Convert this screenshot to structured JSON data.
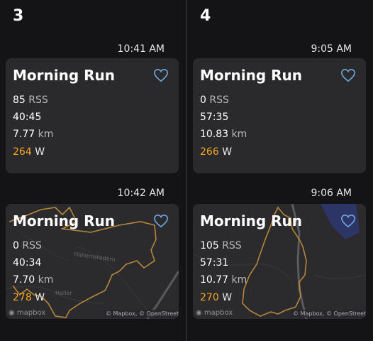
{
  "colors": {
    "background": "#121214",
    "card": "#2a2a2c",
    "power": "#f5a623",
    "heart": "#6fa8dc",
    "route": "#b8863a"
  },
  "columns": [
    {
      "day": "3",
      "activities": [
        {
          "time": "10:41 AM",
          "title": "Morning Run",
          "rss_value": "85",
          "rss_unit": "RSS",
          "duration": "40:45",
          "distance_value": "7.77",
          "distance_unit": "km",
          "power_value": "264",
          "power_unit": "W",
          "has_map": false,
          "favorite_icon": "heart-outline-icon"
        },
        {
          "time": "10:42 AM",
          "title": "Morning Run",
          "rss_value": "0",
          "rss_unit": "RSS",
          "duration": "40:34",
          "distance_value": "7.70",
          "distance_unit": "km",
          "power_value": "278",
          "power_unit": "W",
          "has_map": true,
          "map_labels": [
            "Hallernstedern",
            "Haller"
          ],
          "mapbox_logo": "mapbox",
          "map_attribution": "© Mapbox, © OpenStreetMap",
          "favorite_icon": "heart-outline-icon"
        }
      ]
    },
    {
      "day": "4",
      "activities": [
        {
          "time": "9:05 AM",
          "title": "Morning Run",
          "rss_value": "0",
          "rss_unit": "RSS",
          "duration": "57:35",
          "distance_value": "10.83",
          "distance_unit": "km",
          "power_value": "266",
          "power_unit": "W",
          "has_map": false,
          "favorite_icon": "heart-outline-icon"
        },
        {
          "time": "9:06 AM",
          "title": "Morning Run",
          "rss_value": "105",
          "rss_unit": "RSS",
          "duration": "57:31",
          "distance_value": "10.77",
          "distance_unit": "km",
          "power_value": "270",
          "power_unit": "W",
          "has_map": true,
          "mapbox_logo": "mapbox",
          "map_attribution": "© Mapbox, © OpenStreetMap",
          "favorite_icon": "heart-outline-icon"
        }
      ]
    }
  ]
}
